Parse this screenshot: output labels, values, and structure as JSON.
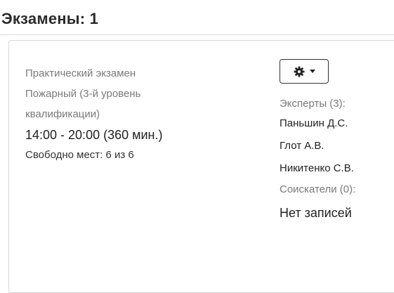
{
  "header": {
    "title": "Экзамены: 1"
  },
  "exam": {
    "type": "Практический экзамен",
    "qualification": "Пожарный (3-й уровень квалификации)",
    "time": "14:00 - 20:00 (360 мин.)",
    "seats": "Свободно мест: 6 из 6"
  },
  "actions": {
    "menu_icon": "gear-icon",
    "dropdown_icon": "caret-down-icon"
  },
  "people": {
    "experts_label": "Эксперты (3):",
    "experts": [
      "Паньшин Д.С.",
      "Глот А.В.",
      "Никитенко С.В."
    ],
    "applicants_label": "Соискатели (0):",
    "empty_label": "Нет записей"
  }
}
